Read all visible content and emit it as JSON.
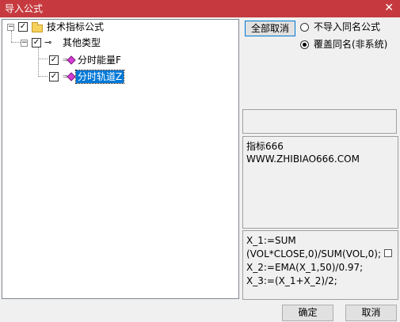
{
  "window": {
    "title": "导入公式",
    "close_glyph": "✕"
  },
  "tree": {
    "root": {
      "label": "技术指标公式",
      "checked": true,
      "expanded": true
    },
    "group": {
      "label": "其他类型",
      "checked": true,
      "expanded": true
    },
    "items": [
      {
        "label": "分时能量F",
        "checked": true,
        "selected": false
      },
      {
        "label": "分时轨道Z",
        "checked": true,
        "selected": true
      }
    ],
    "check_glyph": "✓",
    "expanded_glyph": "−"
  },
  "options": {
    "deselect_all_label": "全部取消",
    "radio_skip_label": "不导入同名公式",
    "radio_overwrite_label": "覆盖同名(非系统)",
    "selected": "overwrite"
  },
  "info": {
    "line1": "指标666",
    "line2": "WWW.ZHIBIAO666.COM"
  },
  "formula": {
    "lines": [
      "X_1:=SUM",
      "(VOL*CLOSE,0)/SUM(VOL,0);",
      "X_2:=EMA(X_1,50)/0.97;",
      "X_3:=(X_1+X_2)/2;"
    ]
  },
  "footer": {
    "ok_label": "确定",
    "cancel_label": "取消"
  }
}
